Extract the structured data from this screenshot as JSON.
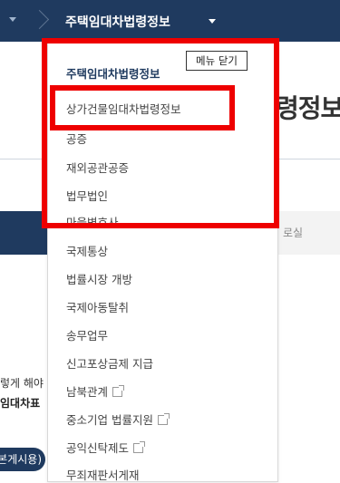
{
  "topbar": {
    "nav_title": "주택임대차법령정보"
  },
  "background": {
    "heading": "령정보",
    "tab_text": "로실",
    "text1": "렇게 해야",
    "text2": "임대차표",
    "pill_text": "본게시용)"
  },
  "menu": {
    "close_label": "메뉴 닫기",
    "items": [
      {
        "label": "주택임대차법령정보",
        "active": true
      },
      {
        "label": "상가건물임대차법령정보"
      },
      {
        "label": "공증"
      },
      {
        "label": "재외공관공증"
      },
      {
        "label": "법무법인"
      },
      {
        "label": "마을변호사"
      },
      {
        "label": "국제통상"
      },
      {
        "label": "법률시장 개방"
      },
      {
        "label": "국제아동탈취"
      },
      {
        "label": "송무업무"
      },
      {
        "label": "신고포상금제 지급"
      },
      {
        "label": "남북관계",
        "external": true
      },
      {
        "label": "중소기업 법률지원",
        "external": true
      },
      {
        "label": "공익신탁제도",
        "external": true
      },
      {
        "label": "무죄재판서게재"
      }
    ]
  },
  "colors": {
    "nav_background": "#1f3a5f",
    "annotation_red": "#ee0000"
  },
  "icons": {
    "external_link": "external-link-icon",
    "dropdown": "chevron-down-icon"
  }
}
